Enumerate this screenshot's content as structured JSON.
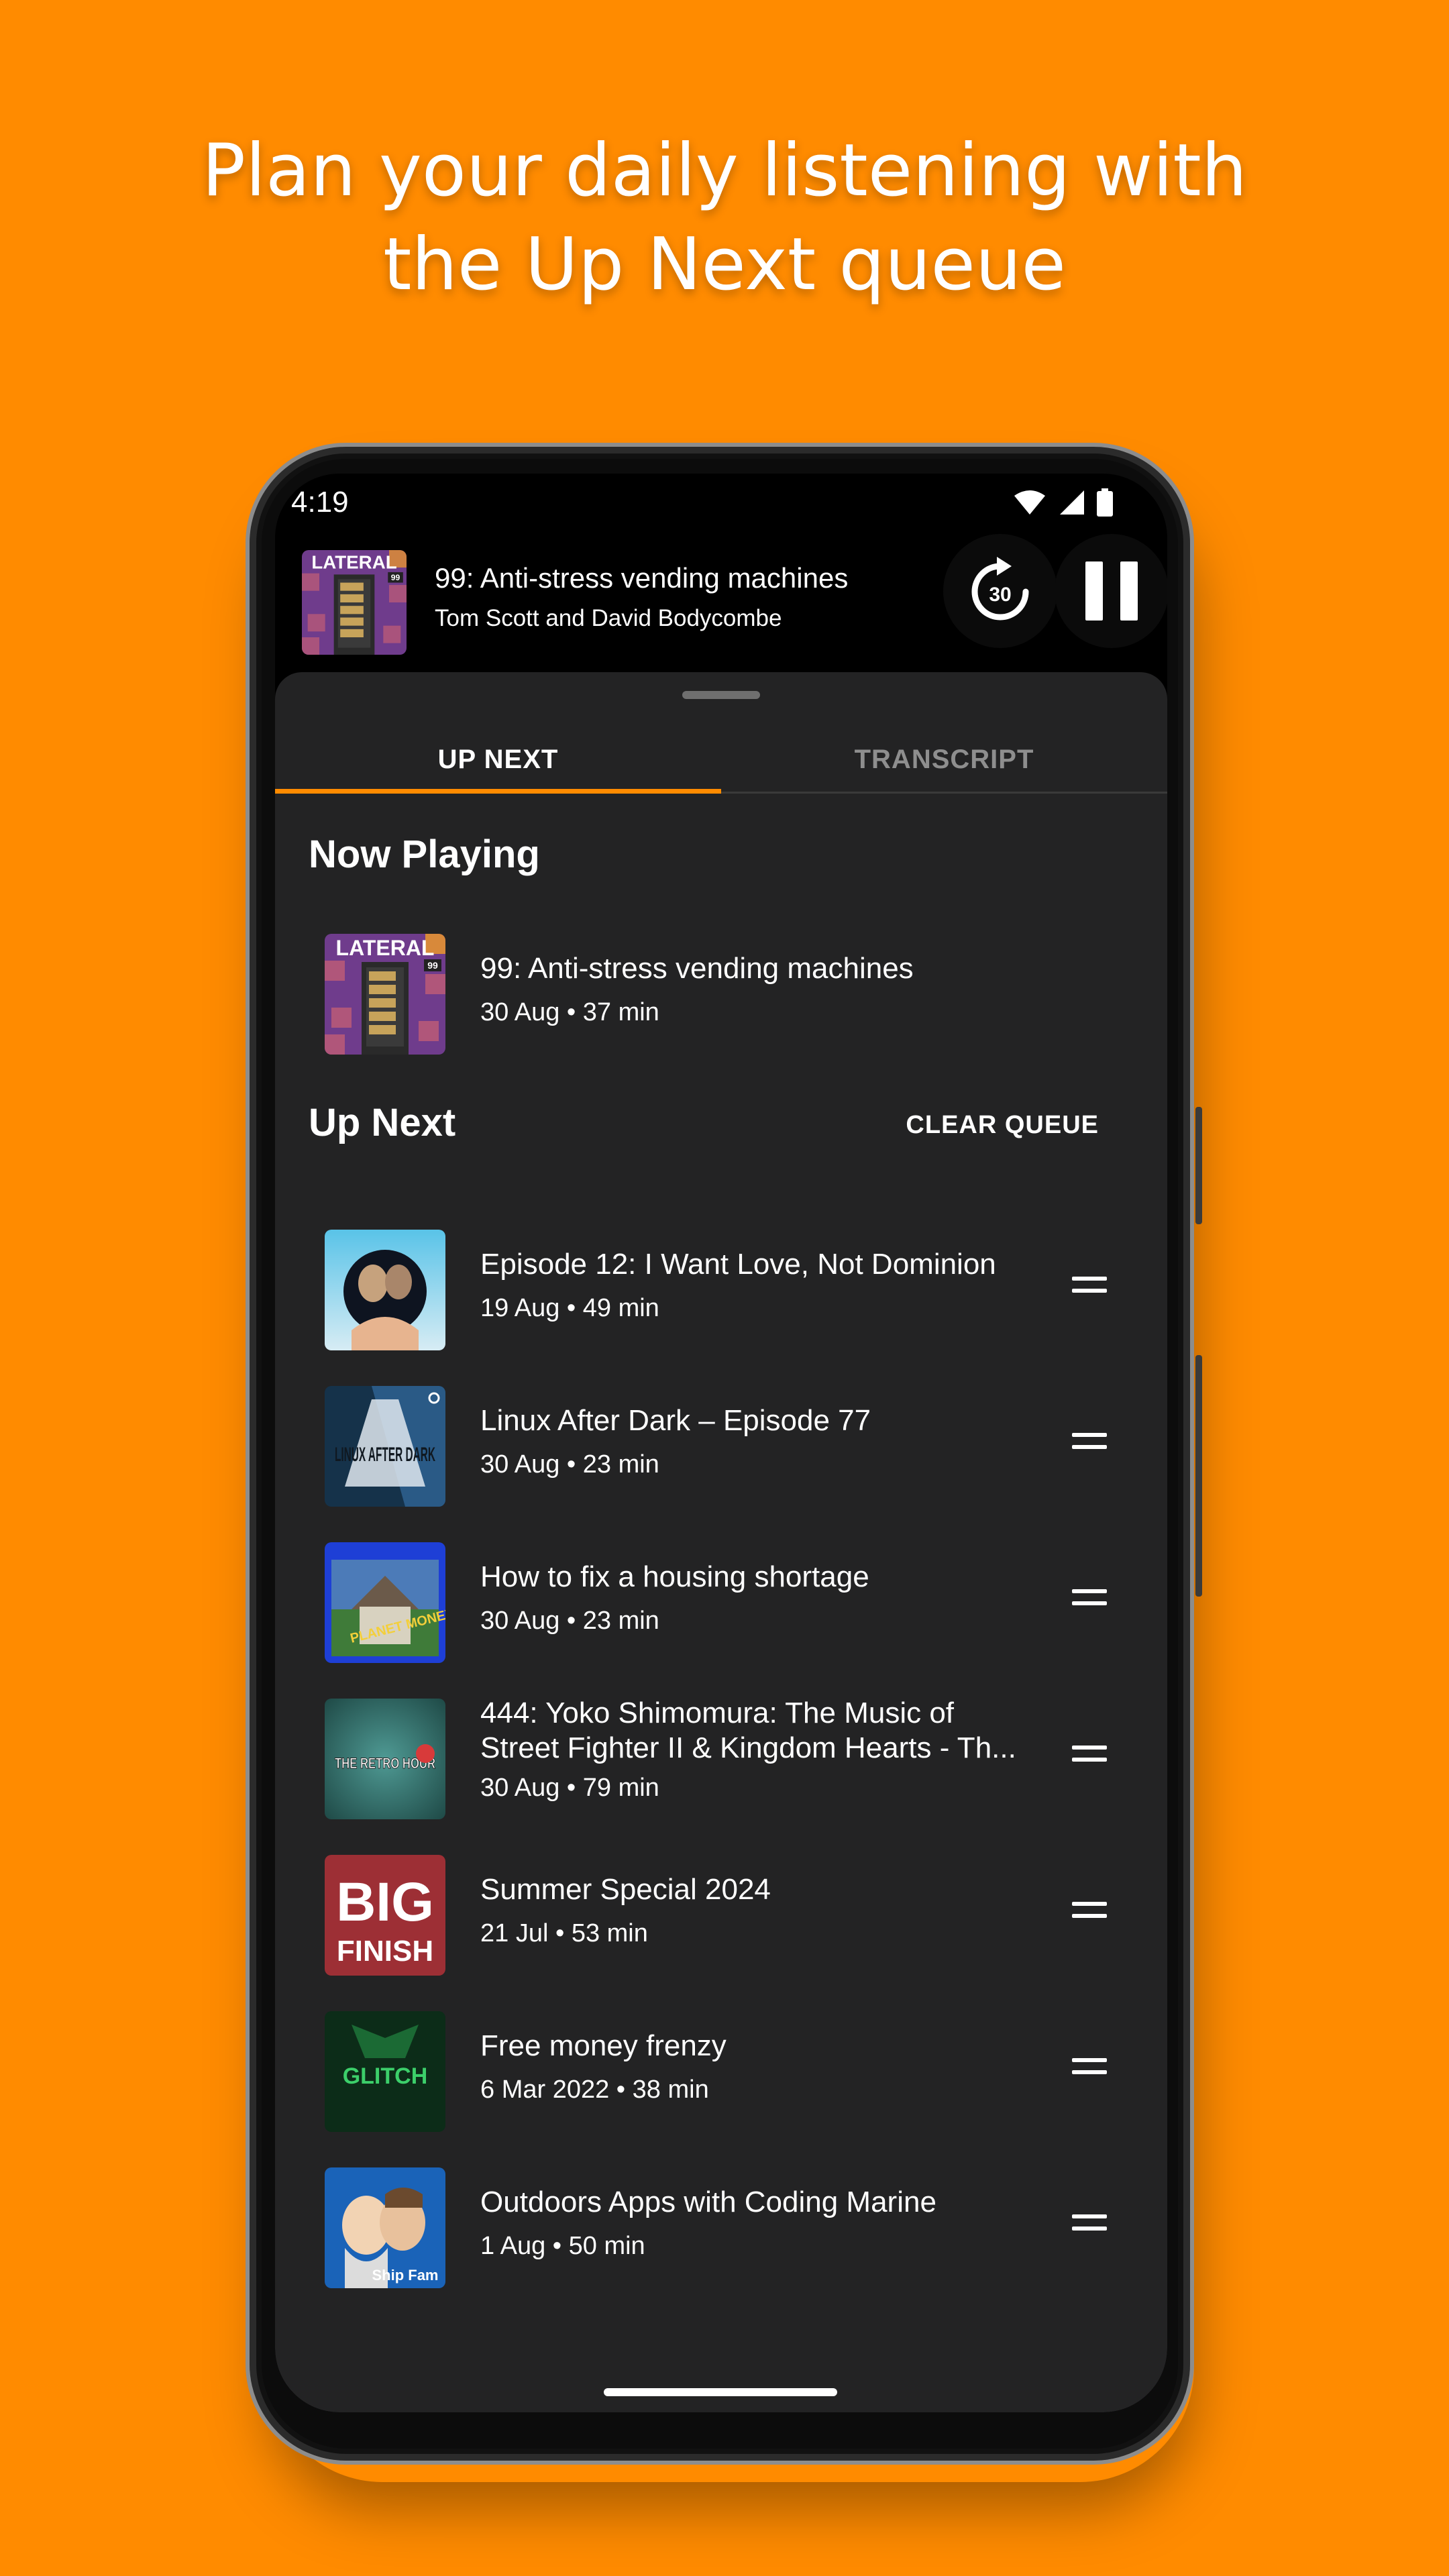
{
  "headline": {
    "line1": "Plan your daily listening with",
    "line2": "the Up Next queue"
  },
  "status_bar": {
    "time": "4:19",
    "icons": [
      "wifi-icon",
      "cellular-signal-icon",
      "battery-icon"
    ]
  },
  "mini_player": {
    "artwork_text": "LATERAL",
    "artwork_badge": "99",
    "title": "99: Anti-stress vending machines",
    "author": "Tom Scott and David Bodycombe",
    "skip_seconds": "30"
  },
  "tabs": [
    {
      "label": "UP NEXT",
      "active": true
    },
    {
      "label": "TRANSCRIPT",
      "active": false
    }
  ],
  "now_playing": {
    "heading": "Now Playing",
    "title": "99: Anti-stress vending machines",
    "meta": "30 Aug • 37 min"
  },
  "up_next": {
    "heading": "Up Next",
    "clear_label": "CLEAR QUEUE",
    "items": [
      {
        "title": "Episode 12: I Want Love, Not Dominion",
        "meta": "19 Aug • 49 min"
      },
      {
        "title": "Linux After Dark – Episode 77",
        "meta": "30 Aug • 23 min",
        "art_text": "LINUX AFTER DARK"
      },
      {
        "title": "How to fix a housing shortage",
        "meta": "30 Aug • 23 min",
        "art_text": "PLANET MONEY"
      },
      {
        "title": "444: Yoko Shimomura: The Music of Street Fighter II & Kingdom Hearts - Th...",
        "meta": "30 Aug • 79 min",
        "art_text": "THE RETRO HOUR"
      },
      {
        "title": "Summer Special 2024",
        "meta": "21 Jul • 53 min",
        "art_text1": "BIG",
        "art_text2": "FINISH"
      },
      {
        "title": "Free money frenzy",
        "meta": "6 Mar 2022 • 38 min",
        "art_text": "GLITCH"
      },
      {
        "title": "Outdoors Apps with Coding Marine",
        "meta": "1 Aug • 50 min",
        "art_text": "Ship Fam"
      }
    ]
  },
  "colors": {
    "background": "#FF8B00",
    "accent": "#FF8B00",
    "sheet": "#232324"
  }
}
